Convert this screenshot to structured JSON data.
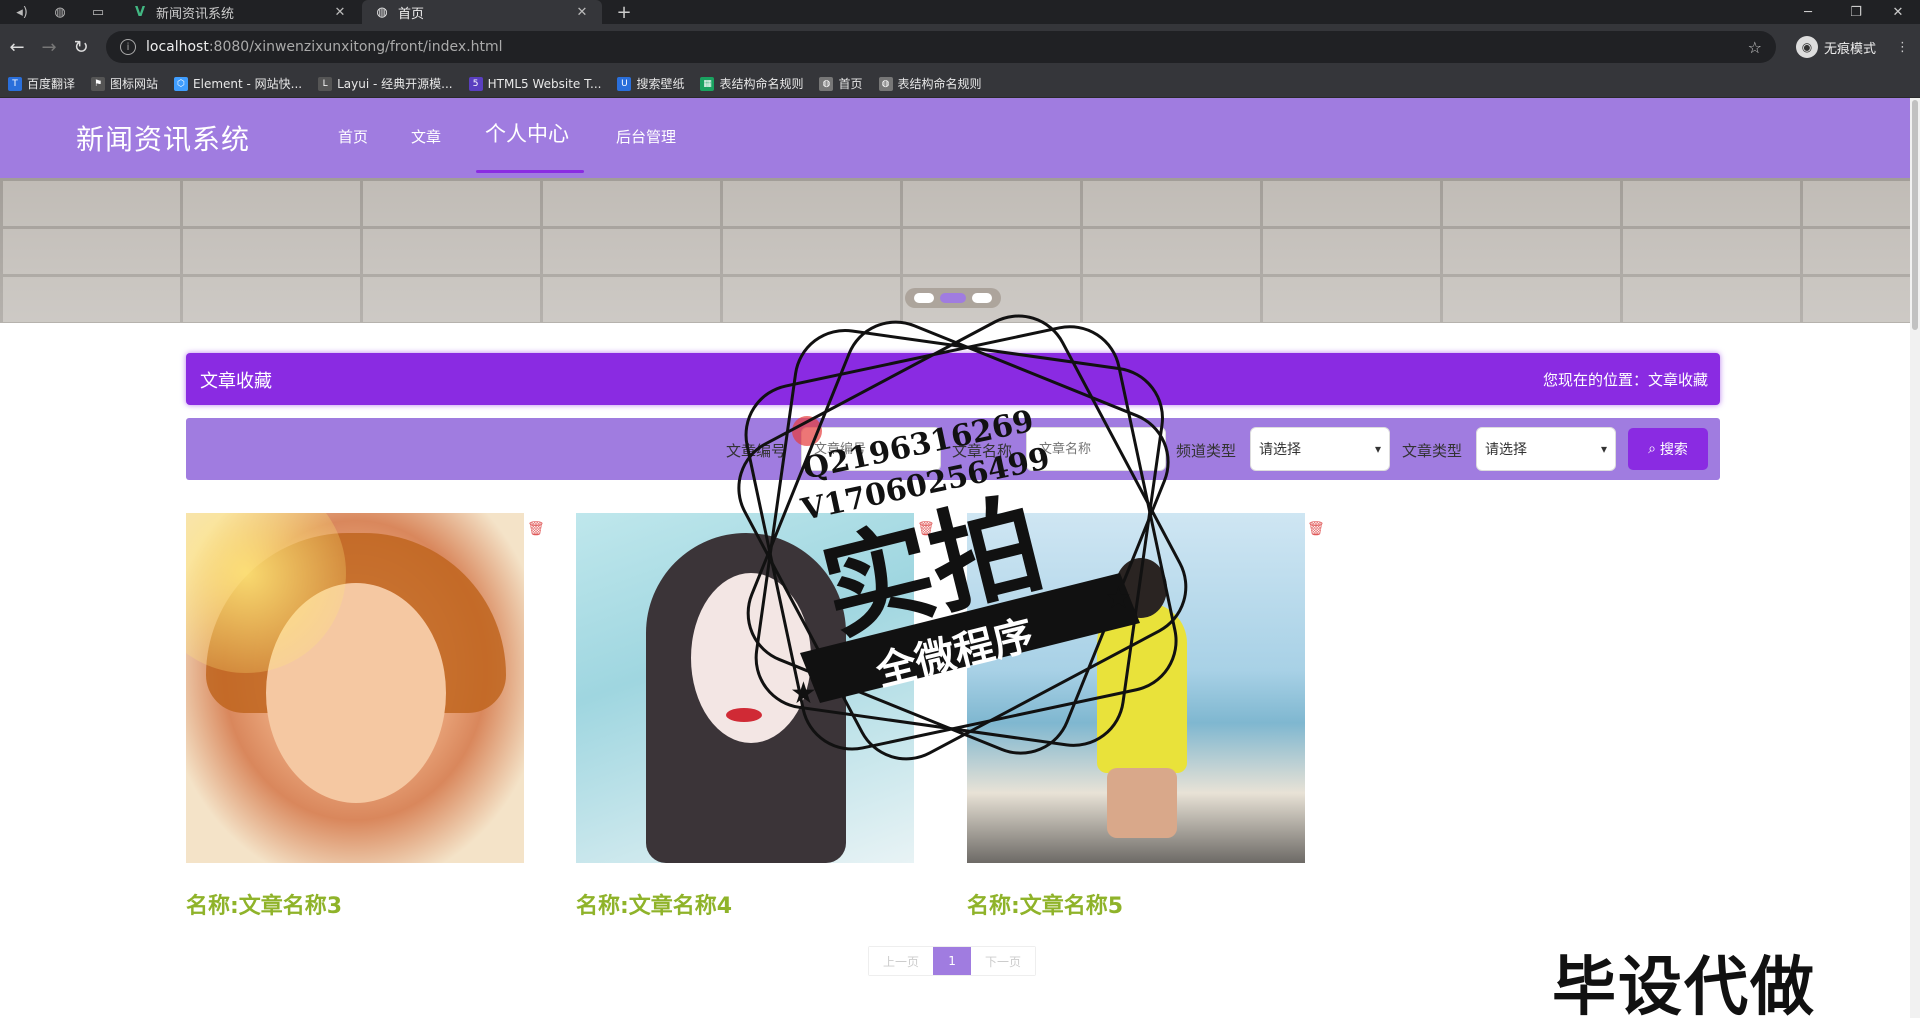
{
  "browser": {
    "tabs": [
      {
        "title": "新闻资讯系统",
        "active": false
      },
      {
        "title": "首页",
        "active": true
      }
    ],
    "url_host": "localhost",
    "url_rest": ":8080/xinwenzixunxitong/front/index.html",
    "incognito_label": "无痕模式",
    "bookmarks": [
      {
        "label": "百度翻译",
        "color": "#2a6fdb"
      },
      {
        "label": "图标网站",
        "color": "#555555"
      },
      {
        "label": "Element - 网站快...",
        "color": "#409eff"
      },
      {
        "label": "Layui - 经典开源模...",
        "color": "#555555"
      },
      {
        "label": "HTML5 Website T...",
        "color": "#5a3fc0"
      },
      {
        "label": "搜索壁纸",
        "color": "#2a6fdb"
      },
      {
        "label": "表结构命名规则",
        "color": "#1aa260"
      },
      {
        "label": "首页",
        "color": "#777777"
      },
      {
        "label": "表结构命名规则",
        "color": "#777777"
      }
    ]
  },
  "site": {
    "title": "新闻资讯系统",
    "nav": [
      {
        "label": "首页",
        "active": false
      },
      {
        "label": "文章",
        "active": false
      },
      {
        "label": "个人中心",
        "active": true
      },
      {
        "label": "后台管理",
        "active": false
      }
    ],
    "accent": "#a07ce0",
    "primary": "#8a2be2"
  },
  "section": {
    "title": "文章收藏",
    "location": "您现在的位置：文章收藏"
  },
  "search": {
    "fields": [
      {
        "label": "文章编号",
        "placeholder": "文章编号",
        "type": "input"
      },
      {
        "label": "文章名称",
        "placeholder": "文章名称",
        "type": "input"
      },
      {
        "label": "频道类型",
        "value": "请选择",
        "type": "select"
      },
      {
        "label": "文章类型",
        "value": "请选择",
        "type": "select"
      }
    ],
    "button_label": "搜索"
  },
  "cards": [
    {
      "name": "名称:文章名称3"
    },
    {
      "name": "名称:文章名称4"
    },
    {
      "name": "名称:文章名称5"
    }
  ],
  "pager": {
    "prev": "上一页",
    "current": "1",
    "next": "下一页"
  },
  "watermark": {
    "qq": "Q2196316269",
    "v": "V17060256499",
    "big": "实拍",
    "ribbon": "全微程序",
    "corner": "毕设代做"
  }
}
